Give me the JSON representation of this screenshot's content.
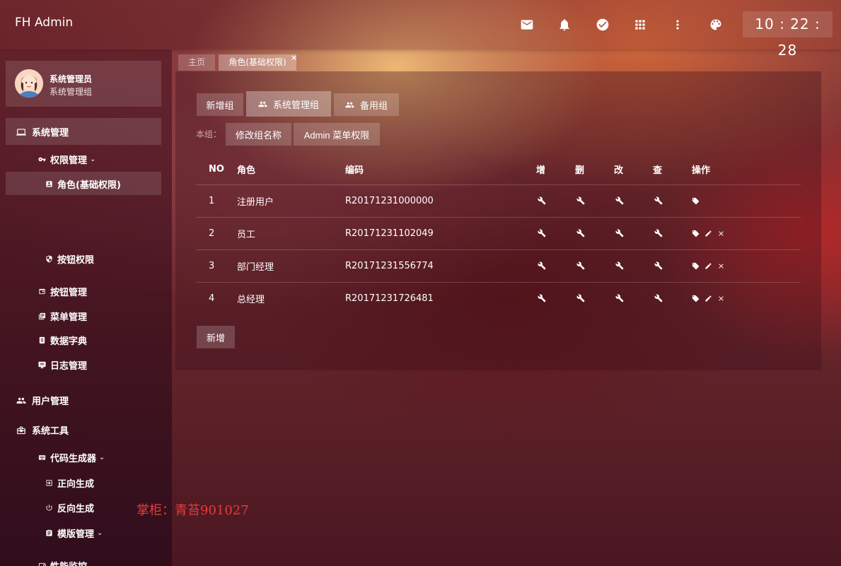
{
  "header": {
    "brand": "FH Admin",
    "icons": [
      "mail-icon",
      "bell-icon",
      "check-circle-icon",
      "grid-icon",
      "more-vert-icon",
      "palette-icon"
    ],
    "clock": "10 : 22 : 28"
  },
  "sidebar": {
    "user": {
      "name": "系统管理员",
      "group": "系统管理组"
    },
    "items": [
      {
        "label": "系统管理",
        "icon": "laptop-icon"
      },
      {
        "label": "权限管理",
        "icon": "key-icon"
      },
      {
        "label": "角色(基础权限)",
        "icon": "badge-icon"
      },
      {
        "label": "按钮权限",
        "icon": "shield-icon"
      },
      {
        "label": "按钮管理",
        "icon": "window-icon"
      },
      {
        "label": "菜单管理",
        "icon": "library-icon"
      },
      {
        "label": "数据字典",
        "icon": "book-icon"
      },
      {
        "label": "日志管理",
        "icon": "monitor-icon"
      },
      {
        "label": "用户管理",
        "icon": "users-icon"
      },
      {
        "label": "系统工具",
        "icon": "briefcase-icon"
      },
      {
        "label": "代码生成器",
        "icon": "keyboard-icon"
      },
      {
        "label": "正向生成",
        "icon": "login-icon"
      },
      {
        "label": "反向生成",
        "icon": "power-icon"
      },
      {
        "label": "模版管理",
        "icon": "clipboard-icon"
      },
      {
        "label": "性能监控",
        "icon": "devices-icon"
      }
    ]
  },
  "tabs": {
    "home": "主页",
    "active": "角色(基础权限)",
    "close": "×"
  },
  "groups": {
    "add_group": "新增组",
    "group1": "系统管理组",
    "group2": "备用组",
    "bz_label": "本组：",
    "rename": "修改组名称",
    "menu_perm": "Admin 菜单权限"
  },
  "table": {
    "headers": [
      "NO",
      "角色",
      "编码",
      "增",
      "删",
      "改",
      "查",
      "操作"
    ],
    "rows": [
      {
        "no": "1",
        "role": "注册用户",
        "code": "R20171231000000"
      },
      {
        "no": "2",
        "role": "员工",
        "code": "R20171231102049"
      },
      {
        "no": "3",
        "role": "部门经理",
        "code": "R20171231556774"
      },
      {
        "no": "4",
        "role": "总经理",
        "code": "R20171231726481"
      }
    ]
  },
  "add_button": "新增",
  "watermark": "掌柜：青苔901027"
}
